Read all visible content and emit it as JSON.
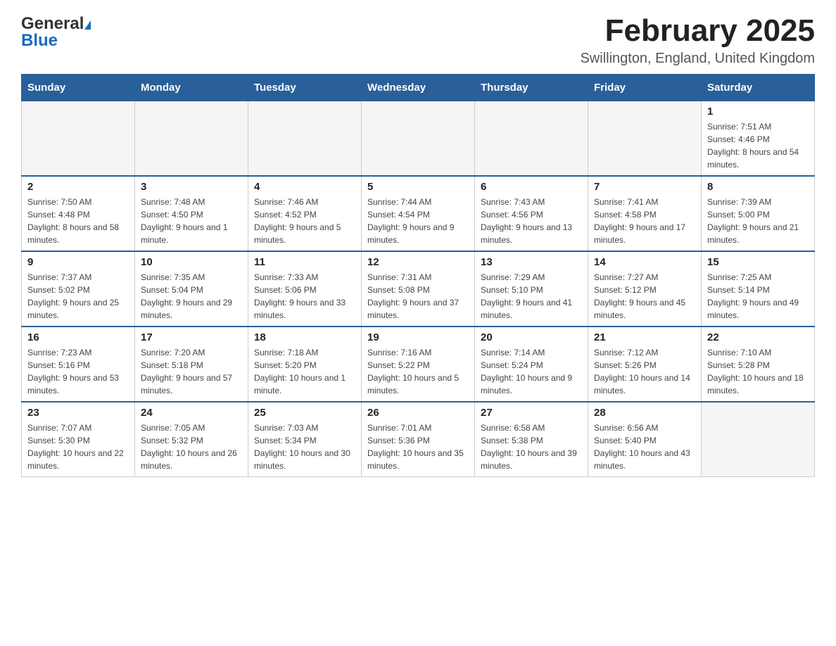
{
  "header": {
    "logo_general": "General",
    "logo_blue": "Blue",
    "month_title": "February 2025",
    "location": "Swillington, England, United Kingdom"
  },
  "weekdays": [
    "Sunday",
    "Monday",
    "Tuesday",
    "Wednesday",
    "Thursday",
    "Friday",
    "Saturday"
  ],
  "weeks": [
    {
      "days": [
        {
          "number": "",
          "sunrise": "",
          "sunset": "",
          "daylight": "",
          "empty": true
        },
        {
          "number": "",
          "sunrise": "",
          "sunset": "",
          "daylight": "",
          "empty": true
        },
        {
          "number": "",
          "sunrise": "",
          "sunset": "",
          "daylight": "",
          "empty": true
        },
        {
          "number": "",
          "sunrise": "",
          "sunset": "",
          "daylight": "",
          "empty": true
        },
        {
          "number": "",
          "sunrise": "",
          "sunset": "",
          "daylight": "",
          "empty": true
        },
        {
          "number": "",
          "sunrise": "",
          "sunset": "",
          "daylight": "",
          "empty": true
        },
        {
          "number": "1",
          "sunrise": "Sunrise: 7:51 AM",
          "sunset": "Sunset: 4:46 PM",
          "daylight": "Daylight: 8 hours and 54 minutes."
        }
      ]
    },
    {
      "days": [
        {
          "number": "2",
          "sunrise": "Sunrise: 7:50 AM",
          "sunset": "Sunset: 4:48 PM",
          "daylight": "Daylight: 8 hours and 58 minutes."
        },
        {
          "number": "3",
          "sunrise": "Sunrise: 7:48 AM",
          "sunset": "Sunset: 4:50 PM",
          "daylight": "Daylight: 9 hours and 1 minute."
        },
        {
          "number": "4",
          "sunrise": "Sunrise: 7:46 AM",
          "sunset": "Sunset: 4:52 PM",
          "daylight": "Daylight: 9 hours and 5 minutes."
        },
        {
          "number": "5",
          "sunrise": "Sunrise: 7:44 AM",
          "sunset": "Sunset: 4:54 PM",
          "daylight": "Daylight: 9 hours and 9 minutes."
        },
        {
          "number": "6",
          "sunrise": "Sunrise: 7:43 AM",
          "sunset": "Sunset: 4:56 PM",
          "daylight": "Daylight: 9 hours and 13 minutes."
        },
        {
          "number": "7",
          "sunrise": "Sunrise: 7:41 AM",
          "sunset": "Sunset: 4:58 PM",
          "daylight": "Daylight: 9 hours and 17 minutes."
        },
        {
          "number": "8",
          "sunrise": "Sunrise: 7:39 AM",
          "sunset": "Sunset: 5:00 PM",
          "daylight": "Daylight: 9 hours and 21 minutes."
        }
      ]
    },
    {
      "days": [
        {
          "number": "9",
          "sunrise": "Sunrise: 7:37 AM",
          "sunset": "Sunset: 5:02 PM",
          "daylight": "Daylight: 9 hours and 25 minutes."
        },
        {
          "number": "10",
          "sunrise": "Sunrise: 7:35 AM",
          "sunset": "Sunset: 5:04 PM",
          "daylight": "Daylight: 9 hours and 29 minutes."
        },
        {
          "number": "11",
          "sunrise": "Sunrise: 7:33 AM",
          "sunset": "Sunset: 5:06 PM",
          "daylight": "Daylight: 9 hours and 33 minutes."
        },
        {
          "number": "12",
          "sunrise": "Sunrise: 7:31 AM",
          "sunset": "Sunset: 5:08 PM",
          "daylight": "Daylight: 9 hours and 37 minutes."
        },
        {
          "number": "13",
          "sunrise": "Sunrise: 7:29 AM",
          "sunset": "Sunset: 5:10 PM",
          "daylight": "Daylight: 9 hours and 41 minutes."
        },
        {
          "number": "14",
          "sunrise": "Sunrise: 7:27 AM",
          "sunset": "Sunset: 5:12 PM",
          "daylight": "Daylight: 9 hours and 45 minutes."
        },
        {
          "number": "15",
          "sunrise": "Sunrise: 7:25 AM",
          "sunset": "Sunset: 5:14 PM",
          "daylight": "Daylight: 9 hours and 49 minutes."
        }
      ]
    },
    {
      "days": [
        {
          "number": "16",
          "sunrise": "Sunrise: 7:23 AM",
          "sunset": "Sunset: 5:16 PM",
          "daylight": "Daylight: 9 hours and 53 minutes."
        },
        {
          "number": "17",
          "sunrise": "Sunrise: 7:20 AM",
          "sunset": "Sunset: 5:18 PM",
          "daylight": "Daylight: 9 hours and 57 minutes."
        },
        {
          "number": "18",
          "sunrise": "Sunrise: 7:18 AM",
          "sunset": "Sunset: 5:20 PM",
          "daylight": "Daylight: 10 hours and 1 minute."
        },
        {
          "number": "19",
          "sunrise": "Sunrise: 7:16 AM",
          "sunset": "Sunset: 5:22 PM",
          "daylight": "Daylight: 10 hours and 5 minutes."
        },
        {
          "number": "20",
          "sunrise": "Sunrise: 7:14 AM",
          "sunset": "Sunset: 5:24 PM",
          "daylight": "Daylight: 10 hours and 9 minutes."
        },
        {
          "number": "21",
          "sunrise": "Sunrise: 7:12 AM",
          "sunset": "Sunset: 5:26 PM",
          "daylight": "Daylight: 10 hours and 14 minutes."
        },
        {
          "number": "22",
          "sunrise": "Sunrise: 7:10 AM",
          "sunset": "Sunset: 5:28 PM",
          "daylight": "Daylight: 10 hours and 18 minutes."
        }
      ]
    },
    {
      "days": [
        {
          "number": "23",
          "sunrise": "Sunrise: 7:07 AM",
          "sunset": "Sunset: 5:30 PM",
          "daylight": "Daylight: 10 hours and 22 minutes."
        },
        {
          "number": "24",
          "sunrise": "Sunrise: 7:05 AM",
          "sunset": "Sunset: 5:32 PM",
          "daylight": "Daylight: 10 hours and 26 minutes."
        },
        {
          "number": "25",
          "sunrise": "Sunrise: 7:03 AM",
          "sunset": "Sunset: 5:34 PM",
          "daylight": "Daylight: 10 hours and 30 minutes."
        },
        {
          "number": "26",
          "sunrise": "Sunrise: 7:01 AM",
          "sunset": "Sunset: 5:36 PM",
          "daylight": "Daylight: 10 hours and 35 minutes."
        },
        {
          "number": "27",
          "sunrise": "Sunrise: 6:58 AM",
          "sunset": "Sunset: 5:38 PM",
          "daylight": "Daylight: 10 hours and 39 minutes."
        },
        {
          "number": "28",
          "sunrise": "Sunrise: 6:56 AM",
          "sunset": "Sunset: 5:40 PM",
          "daylight": "Daylight: 10 hours and 43 minutes."
        },
        {
          "number": "",
          "sunrise": "",
          "sunset": "",
          "daylight": "",
          "empty": true
        }
      ]
    }
  ]
}
